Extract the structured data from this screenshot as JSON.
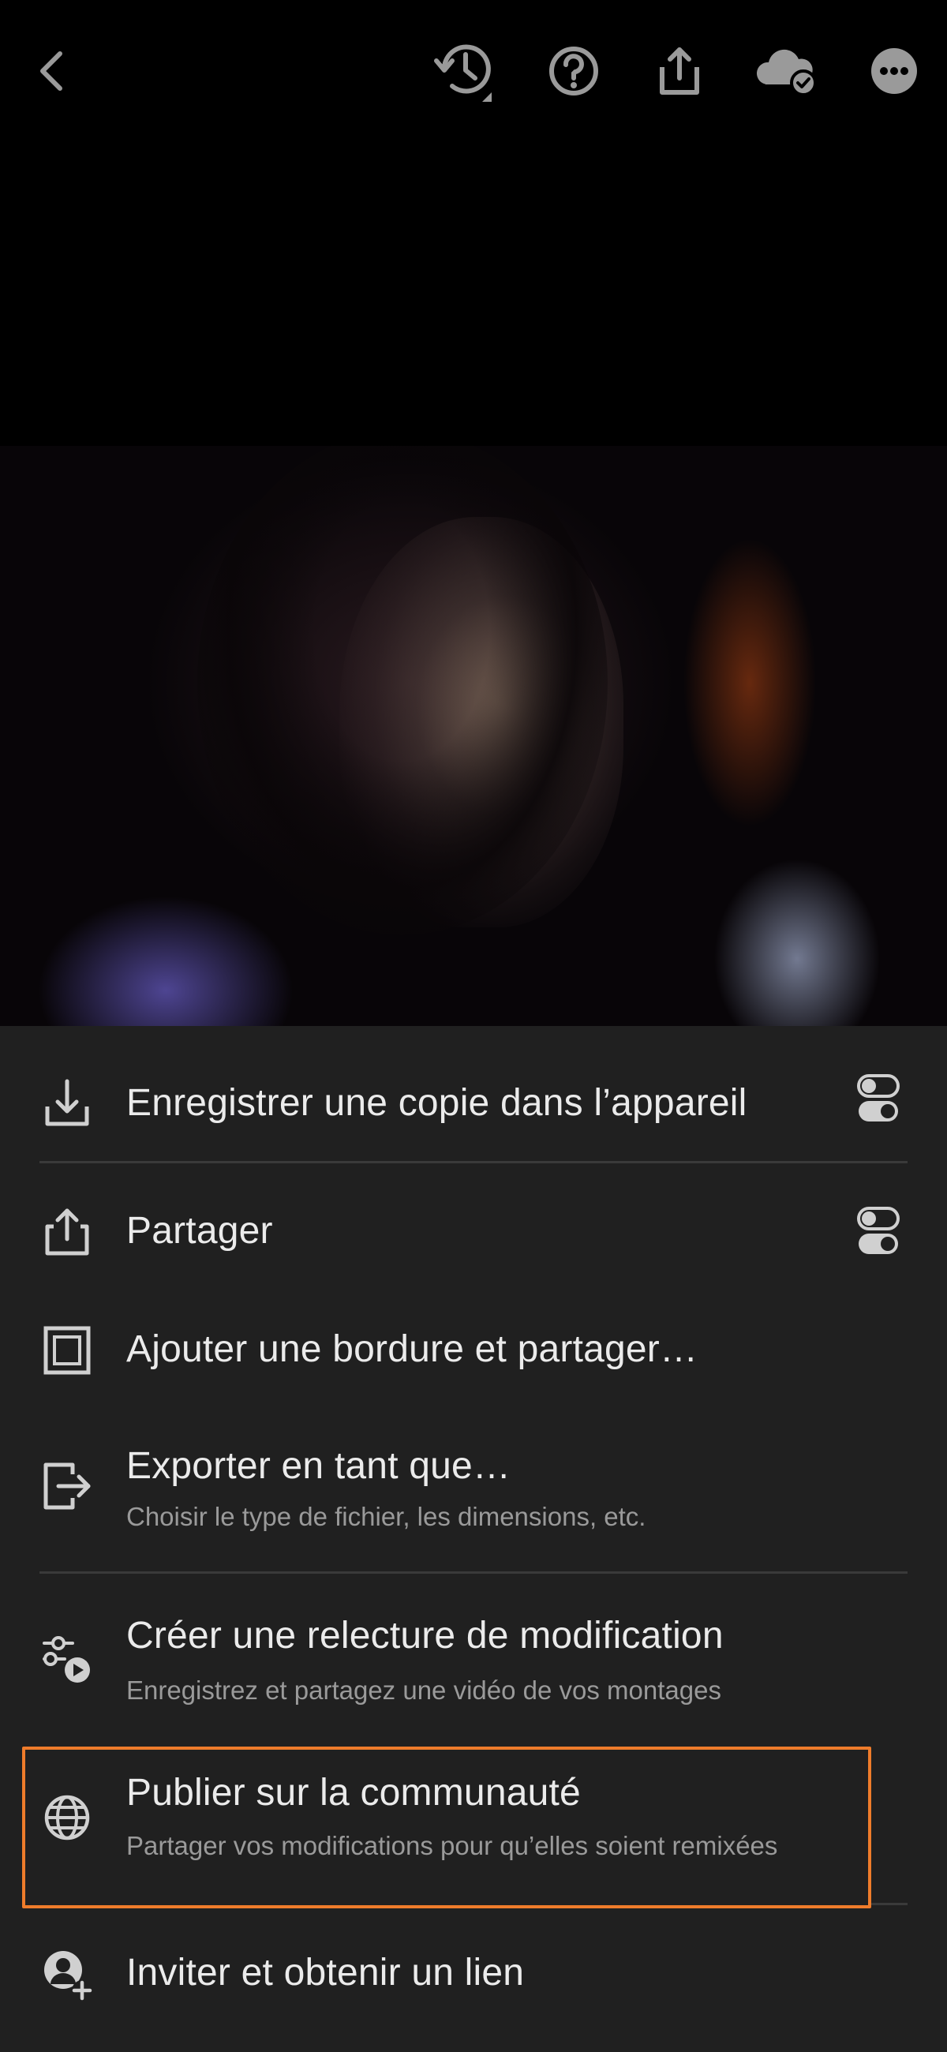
{
  "top_bar": {
    "icons": [
      "back-icon",
      "history-icon",
      "help-icon",
      "share-icon",
      "cloud-synced-icon",
      "more-icon"
    ]
  },
  "menu": {
    "items": [
      {
        "title": "Enregistrer une copie dans l’appareil",
        "subtitle": "",
        "icon": "download-icon",
        "has_settings": true
      },
      {
        "title": "Partager",
        "subtitle": "",
        "icon": "share-icon",
        "has_settings": true
      },
      {
        "title": "Ajouter une bordure et partager…",
        "subtitle": "",
        "icon": "border-icon",
        "has_settings": false
      },
      {
        "title": "Exporter en tant que…",
        "subtitle": "Choisir le type de fichier, les dimensions, etc.",
        "icon": "export-icon",
        "has_settings": false
      },
      {
        "title": "Créer une relecture de modification",
        "subtitle": "Enregistrez et partagez une vidéo de vos montages",
        "icon": "replay-icon",
        "has_settings": false
      },
      {
        "title": "Publier sur la communauté",
        "subtitle": "Partager vos modifications pour qu’elles soient remixées",
        "icon": "globe-icon",
        "has_settings": false,
        "highlighted": true
      },
      {
        "title": "Inviter et obtenir un lien",
        "subtitle": "",
        "icon": "invite-icon",
        "has_settings": false
      }
    ]
  },
  "colors": {
    "background": "#000000",
    "sheet": "#202020",
    "text": "#ebebeb",
    "subtext": "#9a9a9a",
    "highlight": "#ef7c2b"
  }
}
